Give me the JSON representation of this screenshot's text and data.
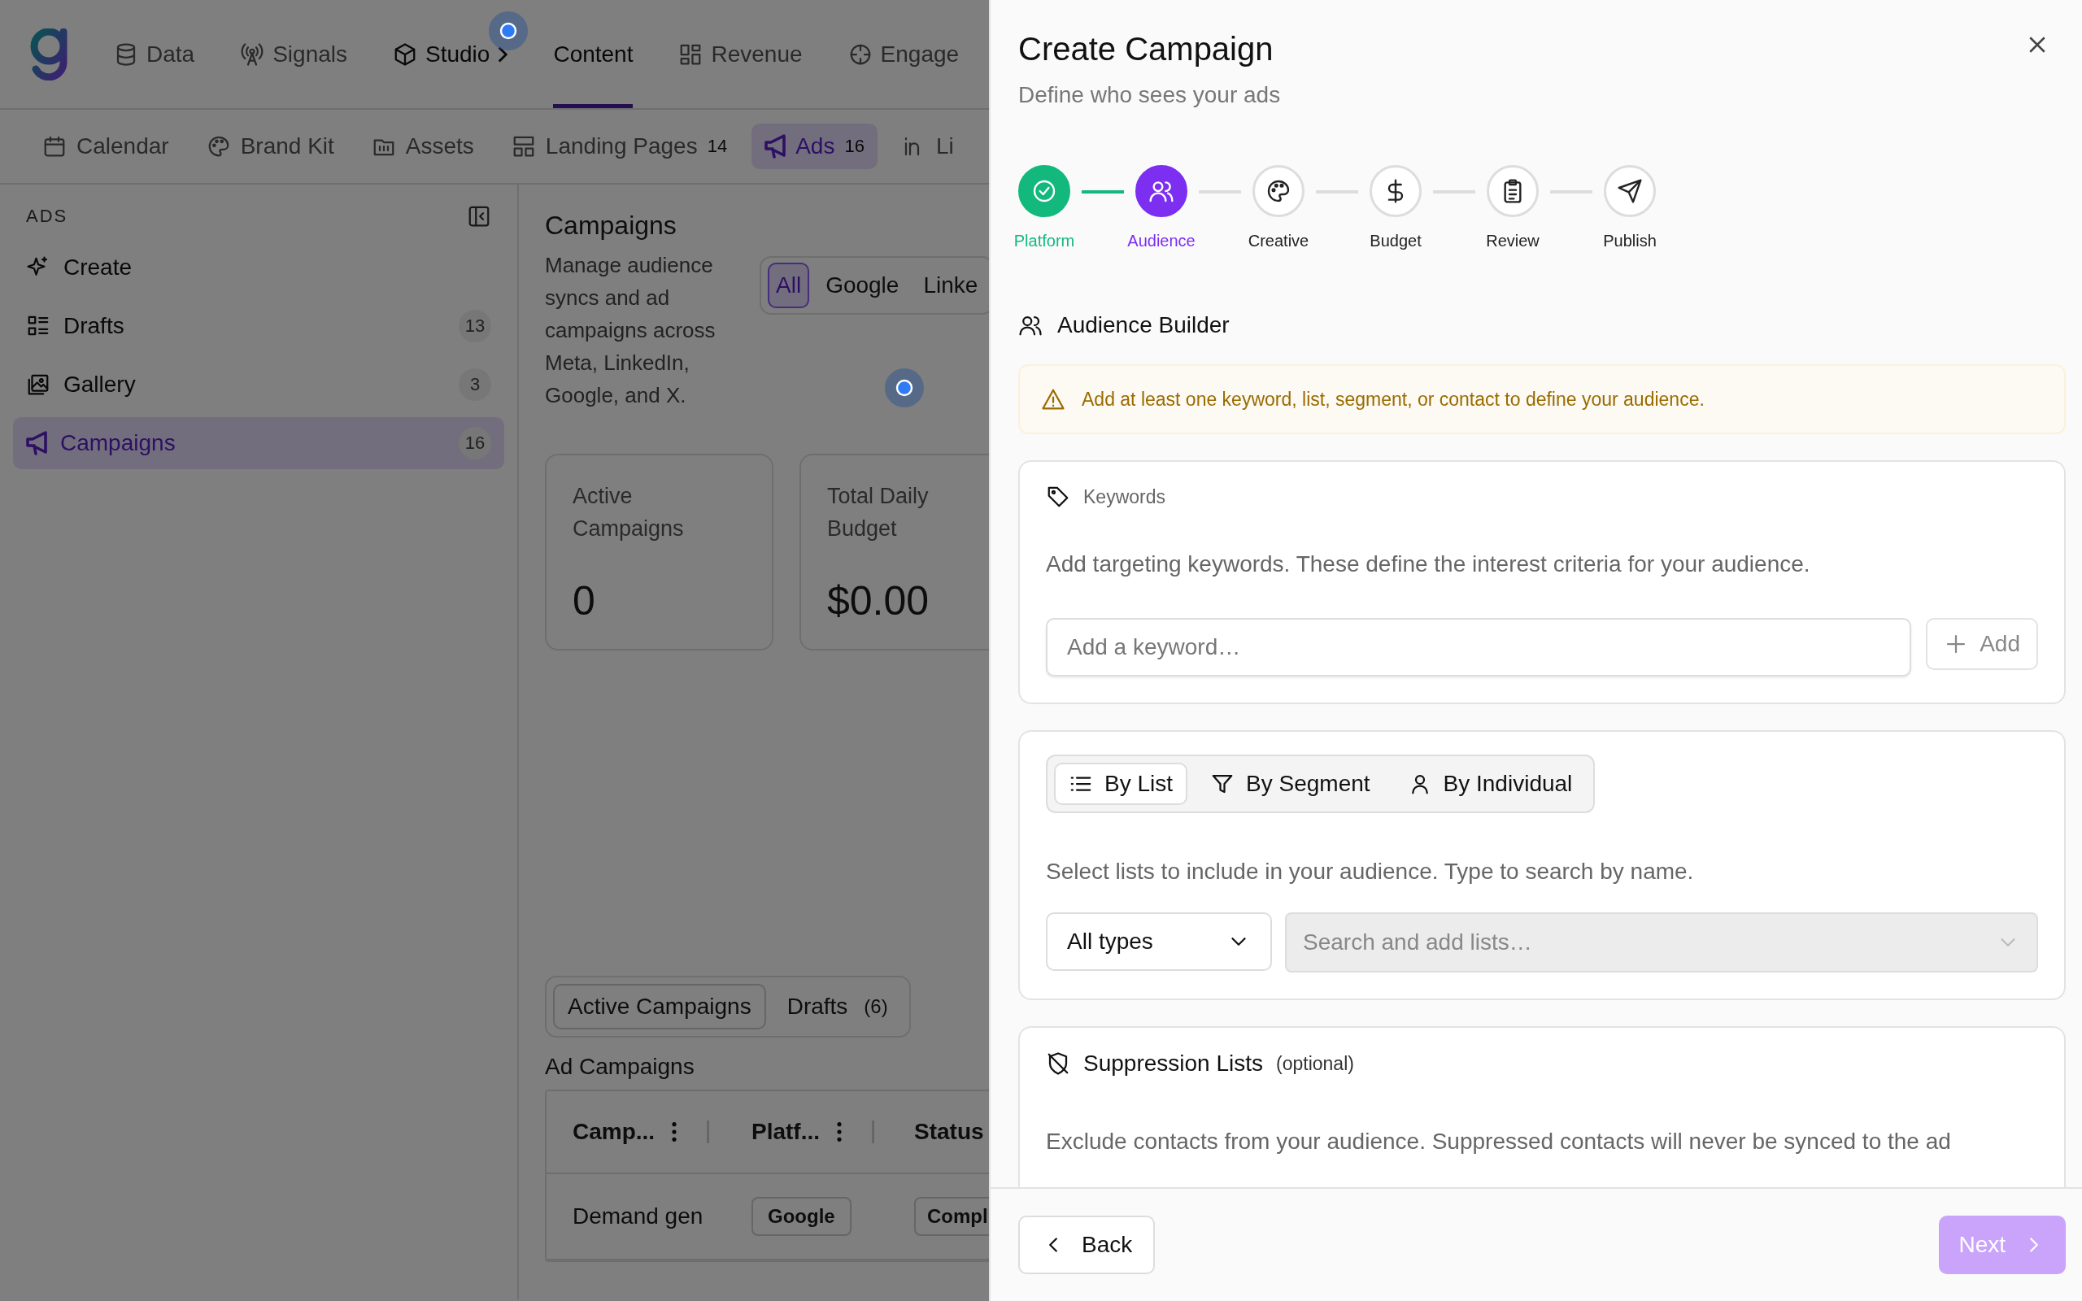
{
  "nav": [
    {
      "label": "Data",
      "selected": false
    },
    {
      "label": "Signals",
      "selected": false
    },
    {
      "label": "Studio",
      "selected": false
    },
    {
      "label": "Content",
      "selected": true
    },
    {
      "label": "Revenue",
      "selected": false
    },
    {
      "label": "Engage",
      "selected": false
    }
  ],
  "subnav": [
    {
      "label": "Calendar",
      "selected": false
    },
    {
      "label": "Brand Kit",
      "selected": false
    },
    {
      "label": "Assets",
      "selected": false
    },
    {
      "label": "Landing Pages",
      "count": "14",
      "selected": false
    },
    {
      "label": "Ads",
      "count": "16",
      "selected": true
    },
    {
      "label": "Li",
      "selected": false
    }
  ],
  "sidebar": {
    "heading": "ADS",
    "items": [
      {
        "label": "Create",
        "selected": false
      },
      {
        "label": "Drafts",
        "count": "13",
        "selected": false
      },
      {
        "label": "Gallery",
        "count": "3",
        "selected": false
      },
      {
        "label": "Campaigns",
        "count": "16",
        "selected": true
      }
    ]
  },
  "main": {
    "title": "Campaigns",
    "description": "Manage audience syncs and ad campaigns across Meta, LinkedIn, Google, and X.",
    "platform_filter": [
      {
        "label": "All",
        "selected": true
      },
      {
        "label": "Google",
        "selected": false
      },
      {
        "label": "Linke",
        "selected": false
      }
    ],
    "stats": [
      {
        "label": "Active Campaigns",
        "value": "0"
      },
      {
        "label": "Total Daily Budget",
        "value": "$0.00"
      }
    ],
    "view_tabs": [
      {
        "label": "Active Campaigns",
        "selected": true
      },
      {
        "label": "Drafts",
        "count": "(6)",
        "selected": false
      }
    ],
    "table": {
      "title": "Ad Campaigns",
      "columns": [
        "Camp...",
        "Platf...",
        "Status"
      ],
      "rows": [
        {
          "cells": [
            "Demand gen",
            "Google",
            "Compl"
          ],
          "kind": "completed"
        }
      ]
    }
  },
  "dialog": {
    "title": "Create Campaign",
    "subtitle": "Define who sees your ads",
    "steps": [
      {
        "label": "Platform",
        "completed": true,
        "selected": false
      },
      {
        "label": "Audience",
        "completed": false,
        "selected": true
      },
      {
        "label": "Creative",
        "completed": false,
        "selected": false
      },
      {
        "label": "Budget",
        "completed": false,
        "selected": false
      },
      {
        "label": "Review",
        "completed": false,
        "selected": false
      },
      {
        "label": "Publish",
        "completed": false,
        "selected": false
      }
    ],
    "section_title": "Audience Builder",
    "warning": "Add at least one keyword, list, segment, or contact to define your audience.",
    "keywords": {
      "title": "Keywords",
      "description": "Add targeting keywords. These define the interest criteria for your audience.",
      "input": {
        "placeholder": "Add a keyword…"
      },
      "add_button": "Add"
    },
    "source_tabs": [
      {
        "label": "By List",
        "selected": true
      },
      {
        "label": "By Segment",
        "selected": false
      },
      {
        "label": "By Individual",
        "selected": false
      }
    ],
    "source_hint": "Select lists to include in your audience. Type to search by name.",
    "type_select": {
      "value": "All types"
    },
    "list_search": {
      "placeholder": "Search and add lists…",
      "disabled": true
    },
    "suppression": {
      "title": "Suppression Lists",
      "note": "(optional)",
      "description": "Exclude contacts from your audience. Suppressed contacts will never be synced to the ad"
    },
    "back_button": "Back",
    "next_button": {
      "label": "Next",
      "disabled": true
    }
  }
}
